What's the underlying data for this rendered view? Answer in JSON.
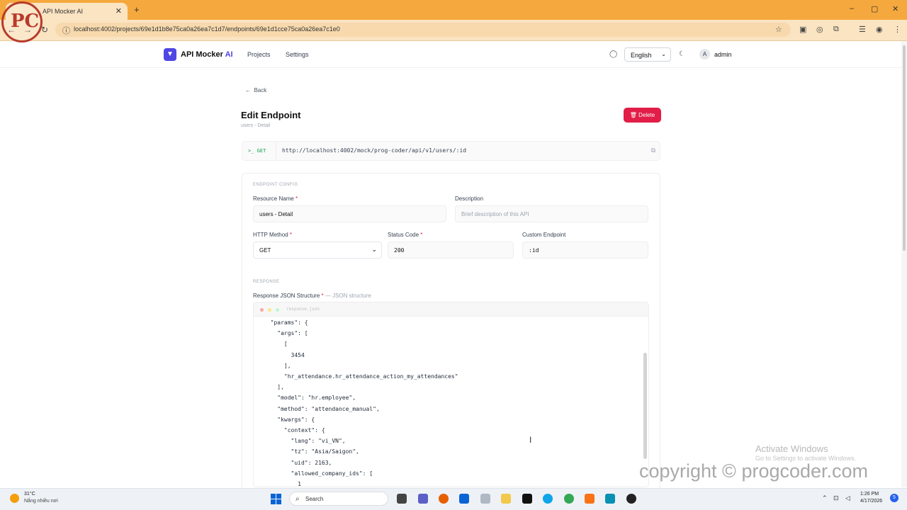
{
  "browser": {
    "tab_title": "API Mocker AI",
    "url": "localhost:4002/projects/69e1d1b8e75ca0a26ea7c1d7/endpoints/69e1d1cce75ca0a26ea7c1e0"
  },
  "header": {
    "app_name": "API Mocker",
    "app_name_ai": "AI",
    "nav": [
      "Projects",
      "Settings"
    ],
    "language": "English",
    "user_initial": "A",
    "user_name": "admin"
  },
  "page": {
    "back_label": "Back",
    "title": "Edit Endpoint",
    "subtitle": "users - Detail",
    "delete_label": "Delete",
    "method_badge": ">_ GET",
    "full_url": "http://localhost:4002/mock/prog-coder/api/v1/users/:id"
  },
  "config": {
    "section_title": "ENDPOINT CONFIG",
    "resource_name_label": "Resource Name",
    "resource_name_value": "users - Detail",
    "description_label": "Description",
    "description_placeholder": "Brief description of this API",
    "method_label": "HTTP Method",
    "method_value": "GET",
    "status_label": "Status Code",
    "status_value": "200",
    "custom_label": "Custom Endpoint",
    "custom_value": ":id",
    "required_mark": "*"
  },
  "response": {
    "section_title": "RESPONSE",
    "json_label": "Response JSON Structure",
    "json_hint": "— JSON structure",
    "file_name": "response.json",
    "code_lines": [
      "  \"params\": {",
      "    \"args\": [",
      "      [",
      "        3454",
      "      ],",
      "      \"hr_attendance.hr_attendance_action_my_attendances\"",
      "    ],",
      "    \"model\": \"hr.employee\",",
      "    \"method\": \"attendance_manual\",",
      "    \"kwargs\": {",
      "      \"context\": {",
      "        \"lang\": \"vi_VN\",",
      "        \"tz\": \"Asia/Saigon\",",
      "        \"uid\": 2163,",
      "        \"allowed_company_ids\": [",
      "          1"
    ]
  },
  "watermark": {
    "activate_title": "Activate Windows",
    "activate_sub": "Go to Settings to activate Windows.",
    "copyright": "copyright © progcoder.com"
  },
  "taskbar": {
    "temperature": "31°C",
    "weather": "Nắng nhiều nơi",
    "search": "Search",
    "time": "1:26 PM",
    "date": "4/17/2026",
    "notif_count": "5"
  },
  "colors": {
    "chrome": "#f5a83d",
    "accent": "#4f46e5",
    "danger": "#e11d48",
    "get": "#16a34a"
  }
}
